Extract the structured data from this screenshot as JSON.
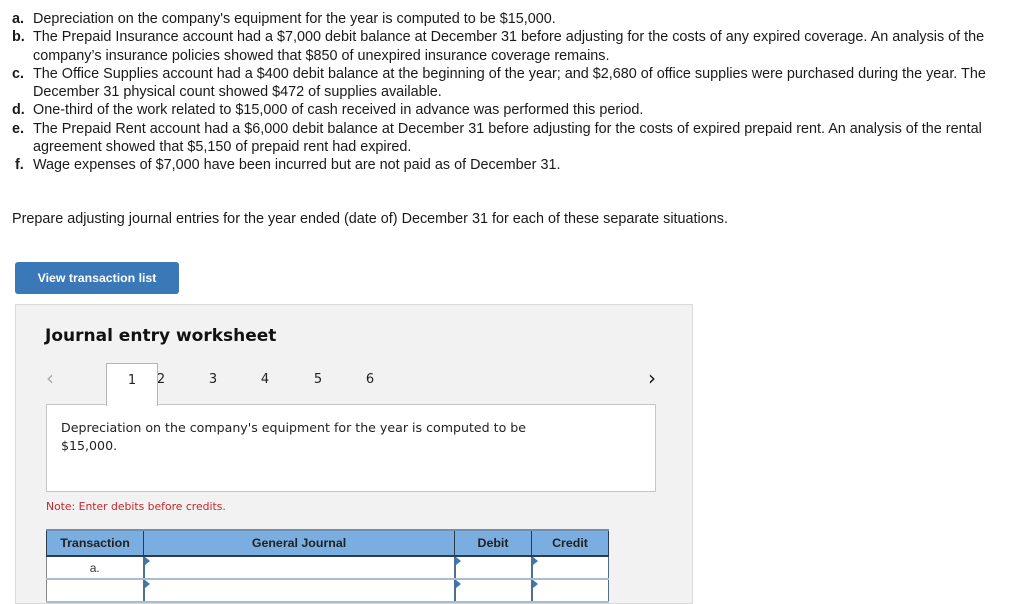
{
  "problems": [
    {
      "label": "a.",
      "text": "Depreciation on the company's equipment for the year is computed to be $15,000."
    },
    {
      "label": "b.",
      "text": "The Prepaid Insurance account had a $7,000 debit balance at December 31 before adjusting for the costs of any expired coverage. An analysis of the company’s insurance policies showed that $850 of unexpired insurance coverage remains."
    },
    {
      "label": "c.",
      "text": "The Office Supplies account had a $400 debit balance at the beginning of the year; and $2,680 of office supplies were purchased during the year. The December 31 physical count showed $472 of supplies available."
    },
    {
      "label": "d.",
      "text": "One-third of the work related to $15,000 of cash received in advance was performed this period."
    },
    {
      "label": "e.",
      "text": "The Prepaid Rent account had a $6,000 debit balance at December 31 before adjusting for the costs of expired prepaid rent. An analysis of the rental agreement showed that $5,150 of prepaid rent had expired."
    },
    {
      "label": "f.",
      "text": "Wage expenses of $7,000 have been incurred but are not paid as of December 31."
    }
  ],
  "instruction": "Prepare adjusting journal entries for the year ended (date of) December 31 for each of these separate situations.",
  "view_button_label": "View transaction list",
  "worksheet": {
    "title": "Journal entry worksheet",
    "prev_icon": "‹",
    "next_icon": "›",
    "tabs": [
      "1",
      "2",
      "3",
      "4",
      "5",
      "6"
    ],
    "active_tab": "1",
    "description": "Depreciation on the company's equipment for the year is computed to be $15,000.",
    "note": "Note: Enter debits before credits.",
    "table": {
      "headers": [
        "Transaction",
        "General Journal",
        "Debit",
        "Credit"
      ],
      "rows": [
        {
          "transaction": "a.",
          "general_journal": "",
          "debit": "",
          "credit": ""
        },
        {
          "transaction": "",
          "general_journal": "",
          "debit": "",
          "credit": ""
        }
      ]
    }
  },
  "colors": {
    "button_bg": "#3b78b8",
    "table_header_bg": "#7aade0",
    "note_text": "#c0272d",
    "worksheet_bg": "#f2f2f2"
  }
}
